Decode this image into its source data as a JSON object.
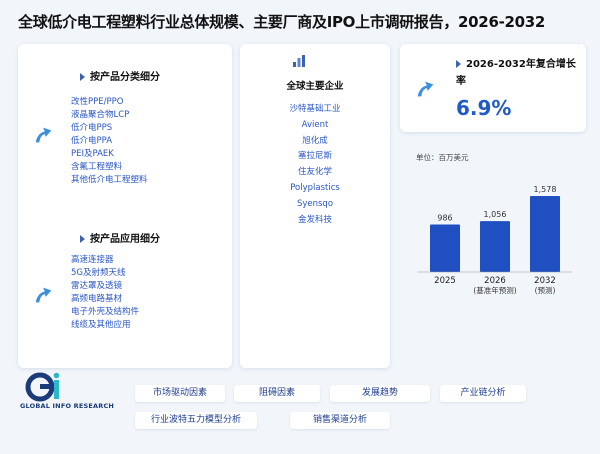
{
  "title": "全球低介电工程塑料行业总体规模、主要厂商及IPO上市调研报告，2026-2032",
  "left_panel": {
    "product_type": {
      "heading": "按产品分类细分",
      "items": [
        "改性PPE/PPO",
        "液晶聚合物LCP",
        "低介电PPS",
        "低介电PPA",
        "PEI及PAEK",
        "含氟工程塑料",
        "其他低介电工程塑料"
      ]
    },
    "application": {
      "heading": "按产品应用细分",
      "items": [
        "高速连接器",
        "5G及射频天线",
        "雷达罩及透镜",
        "高频电路基材",
        "电子外壳及结构件",
        "线缆及其他应用"
      ]
    }
  },
  "middle_panel": {
    "heading": "全球主要企业",
    "companies": [
      "沙特基础工业",
      "Avient",
      "旭化成",
      "塞拉尼斯",
      "住友化学",
      "Polyplastics",
      "Syensqo",
      "金发科技"
    ]
  },
  "kpi": {
    "label": "2026-2032年复合增长率",
    "value": "6.9%"
  },
  "chart_data": {
    "type": "bar",
    "unit_label": "单位：百万美元",
    "categories": [
      "2025",
      "2026",
      "2032"
    ],
    "category_sublabels": [
      "",
      "(基准年预测)",
      "(预测)"
    ],
    "values": [
      986,
      1056,
      1578
    ],
    "value_labels": [
      "986",
      "1,056",
      "1,578"
    ],
    "color": "#1f4fc0"
  },
  "footer": {
    "logo_text": "GLOBAL INFO RESEARCH",
    "tags": [
      "市场驱动因素",
      "阻碍因素",
      "发展趋势",
      "产业链分析",
      "行业波特五力模型分析",
      "销售渠道分析"
    ]
  }
}
